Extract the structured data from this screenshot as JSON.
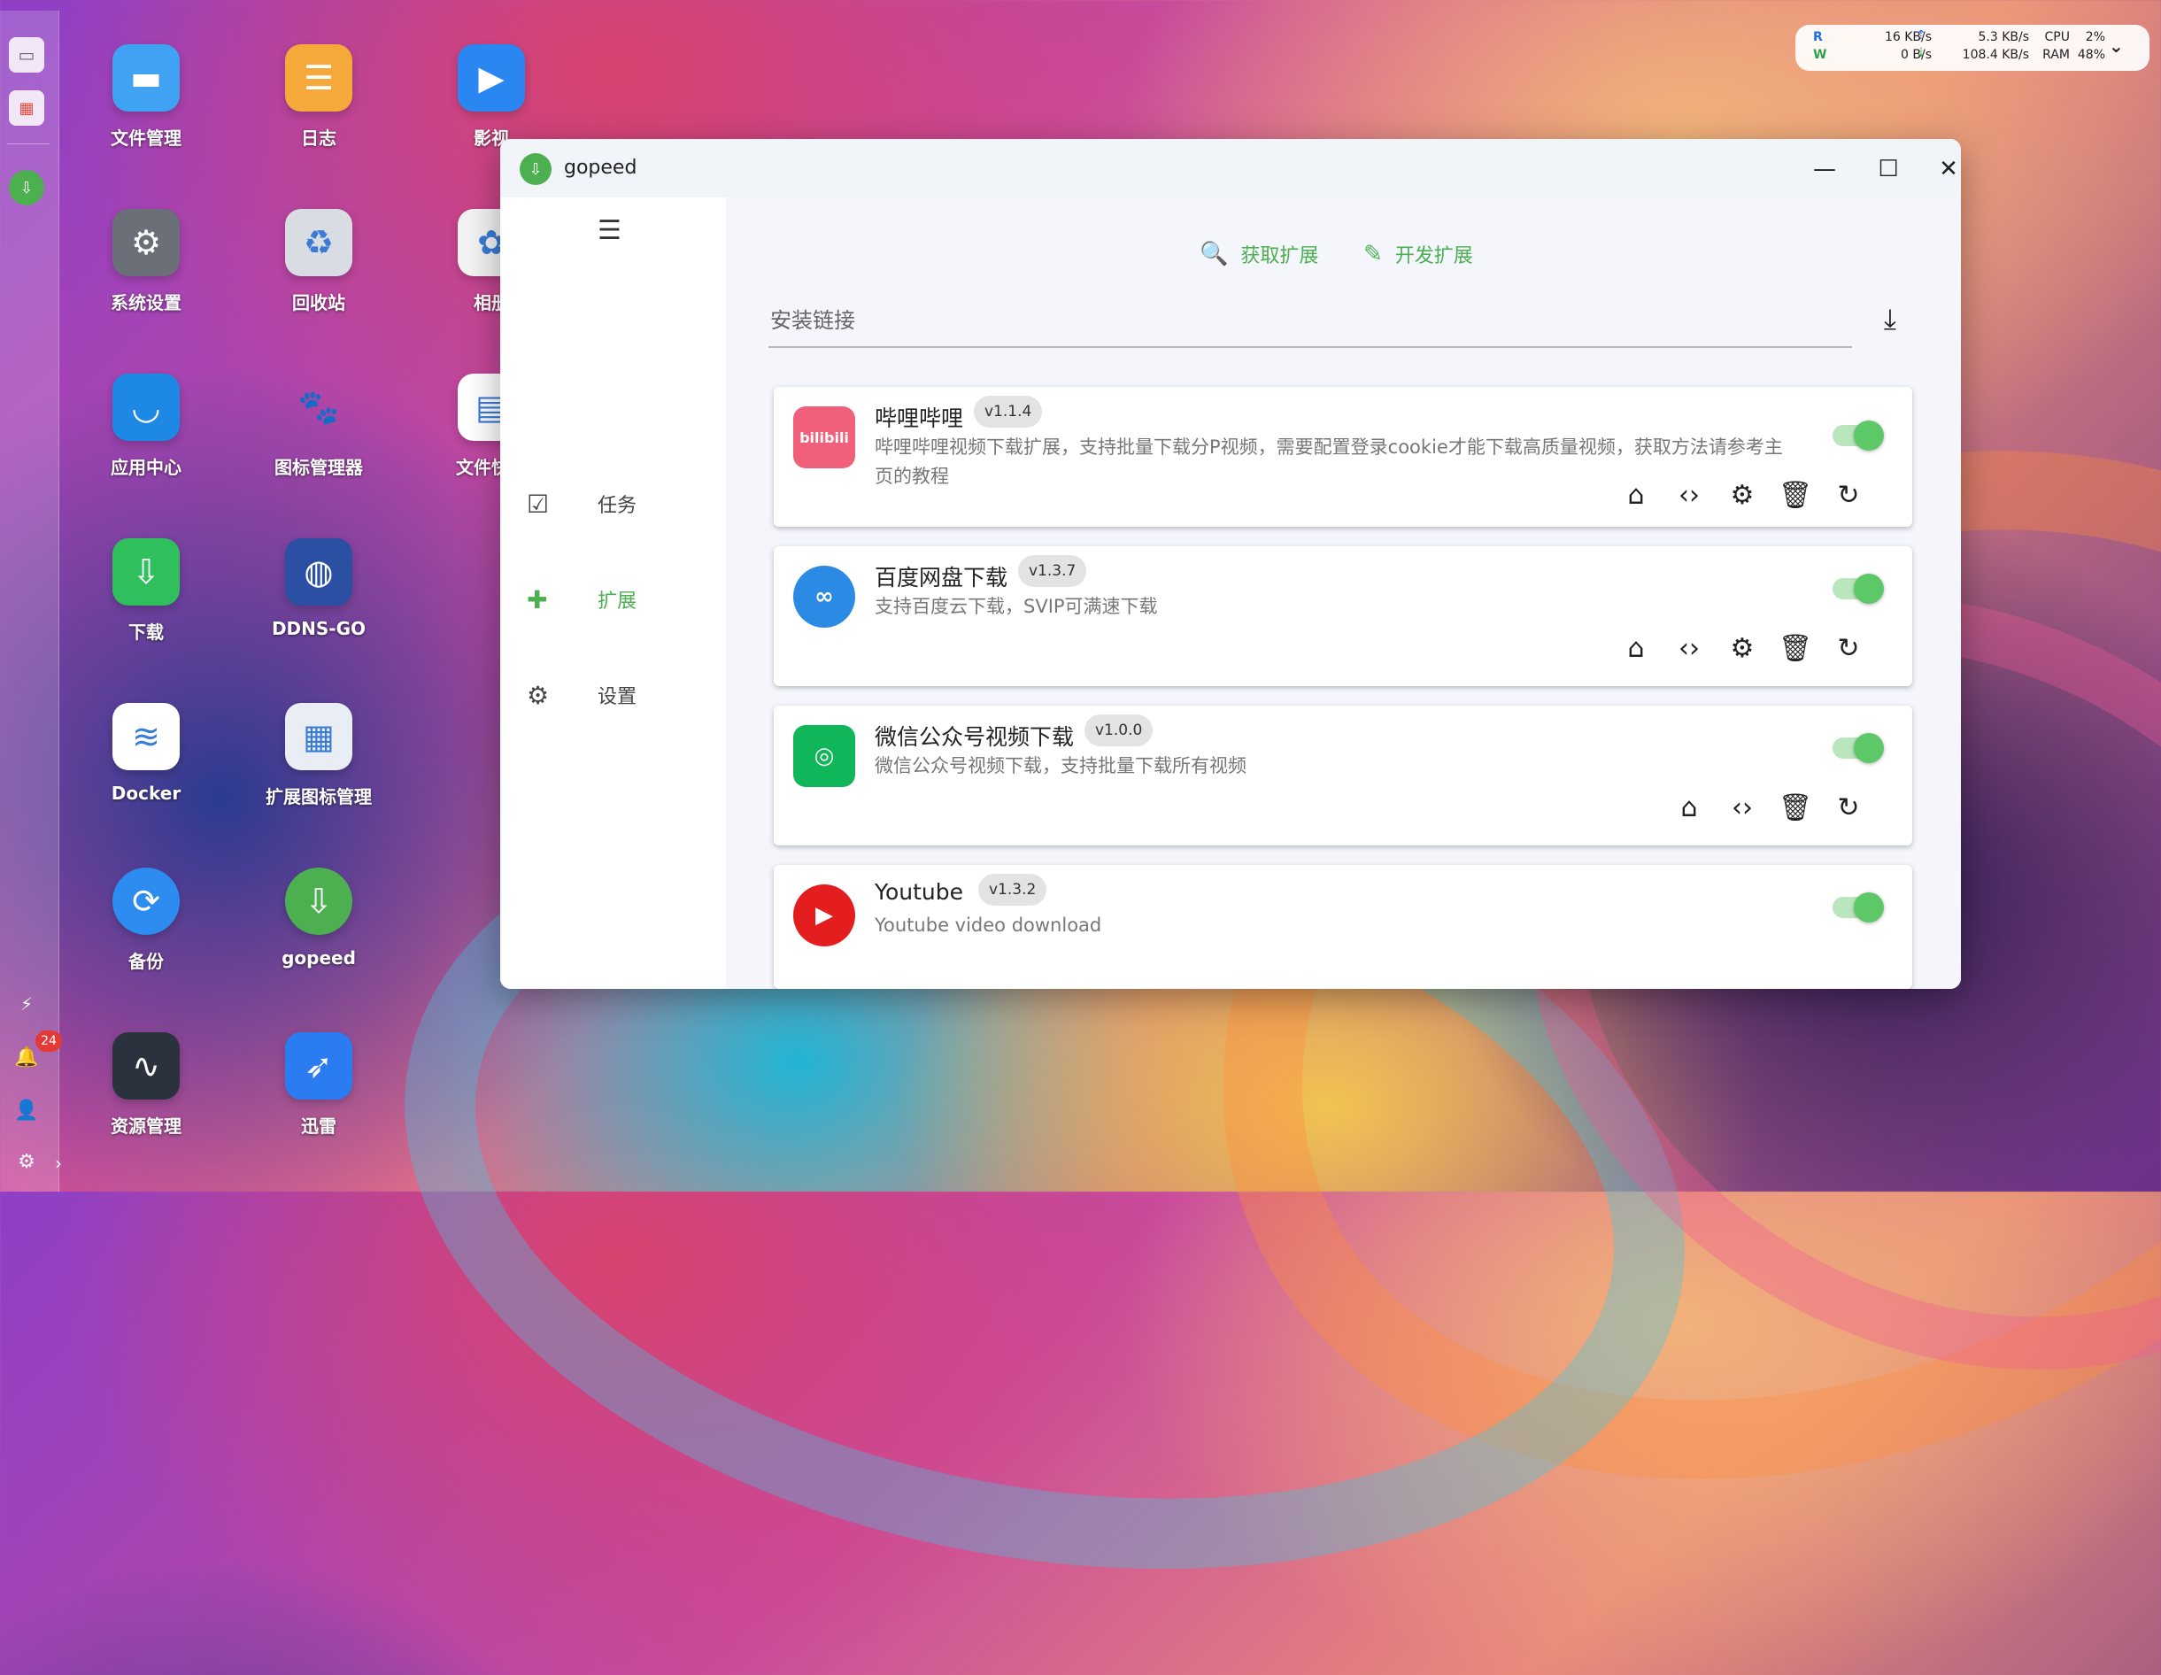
{
  "desktop": {
    "icons": [
      {
        "label": "文件管理",
        "icon": "folder-icon",
        "color": "#3fa2f2"
      },
      {
        "label": "日志",
        "icon": "log-icon",
        "color": "#f6a93b"
      },
      {
        "label": "影视",
        "icon": "video-icon",
        "color": "#2a86f0"
      },
      {
        "label": "系统设置",
        "icon": "gear-icon",
        "color": "#6b6f77"
      },
      {
        "label": "回收站",
        "icon": "recycle-icon",
        "color": "#d9dde3"
      },
      {
        "label": "相册",
        "icon": "photo-icon",
        "color": "#f3f3f3"
      },
      {
        "label": "应用中心",
        "icon": "store-icon",
        "color": "#1e88e5"
      },
      {
        "label": "图标管理器",
        "icon": "paw-icon",
        "color": "transparent"
      },
      {
        "label": "文件快递",
        "icon": "file-transfer-icon",
        "color": "#ffffff"
      },
      {
        "label": "下载",
        "icon": "download-icon",
        "color": "#2fbf5d"
      },
      {
        "label": "DDNS-GO",
        "icon": "globe-icon",
        "color": "#2b4fa3"
      },
      {
        "label": "Docker",
        "icon": "docker-icon",
        "color": "#ffffff"
      },
      {
        "label": "扩展图标管理",
        "icon": "grid-icon",
        "color": "#e9eef5"
      },
      {
        "label": "备份",
        "icon": "backup-icon",
        "color": "#2d8cf0"
      },
      {
        "label": "gopeed",
        "icon": "gopeed-icon",
        "color": "#4caf50"
      },
      {
        "label": "资源管理",
        "icon": "monitor-icon",
        "color": "#29323d"
      },
      {
        "label": "迅雷",
        "icon": "bird-icon",
        "color": "#2b7cf0"
      }
    ],
    "notification_count": "24"
  },
  "widget": {
    "r_label": "R",
    "w_label": "W",
    "read_speed": "16 KB/s",
    "write_speed": "0  B/s",
    "up_speed": "5.3 KB/s",
    "down_speed": "108.4 KB/s",
    "cpu_label": "CPU",
    "ram_label": "RAM",
    "cpu_value": "2%",
    "ram_value": "48%"
  },
  "window": {
    "title": "gopeed",
    "nav": [
      {
        "label": "任务",
        "icon": "task-icon"
      },
      {
        "label": "扩展",
        "icon": "puzzle-icon",
        "active": true
      },
      {
        "label": "设置",
        "icon": "gear-icon"
      }
    ],
    "actions": {
      "get_ext": "获取扩展",
      "dev_ext": "开发扩展"
    },
    "install_placeholder": "安装链接",
    "extensions": [
      {
        "name": "哔哩哔哩",
        "version": "v1.1.4",
        "desc": "哔哩哔哩视频下载扩展，支持批量下载分P视频，需要配置登录cookie才能下载高质量视频，获取方法请参考主页的教程",
        "logo_text": "bilibili",
        "logo_color": "#f0607a",
        "enabled": true
      },
      {
        "name": "百度网盘下载",
        "version": "v1.3.7",
        "desc": "支持百度云下载，SVIP可满速下载",
        "logo_text": "∞",
        "logo_color": "#2b8ae3",
        "enabled": true
      },
      {
        "name": "微信公众号视频下载",
        "version": "v1.0.0",
        "desc": "微信公众号视频下载，支持批量下载所有视频",
        "logo_text": "◎",
        "logo_color": "#10b65a",
        "enabled": true
      },
      {
        "name": "Youtube",
        "version": "v1.3.2",
        "desc": "Youtube video download",
        "logo_text": "▶",
        "logo_color": "#e41e1e",
        "enabled": true
      }
    ]
  }
}
